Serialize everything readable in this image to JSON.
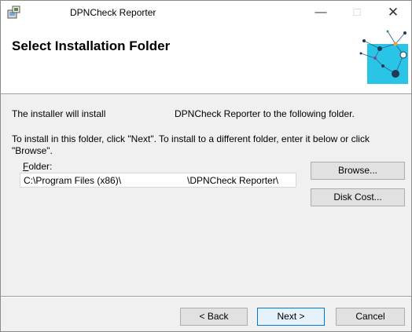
{
  "window": {
    "title": "DPNCheck Reporter",
    "controls": {
      "minimize": "—",
      "maximize": "□",
      "close": "✕"
    }
  },
  "banner": {
    "title": "Select Installation Folder",
    "graphic_color": "#29c4e6"
  },
  "body": {
    "intro_part1": "The installer will install",
    "intro_part2": "DPNCheck Reporter to the following folder.",
    "instructions": "To install in this folder, click \"Next\". To install to a different folder, enter it below or click \"Browse\".",
    "folder_label_accel": "F",
    "folder_label_rest": "older:",
    "folder_value_part1": "C:\\Program Files (x86)\\",
    "folder_value_part2": "\\DPNCheck Reporter\\"
  },
  "buttons": {
    "browse": "Browse...",
    "disk_cost": "Disk Cost...",
    "back": "< Back",
    "next": "Next >",
    "cancel": "Cancel"
  }
}
